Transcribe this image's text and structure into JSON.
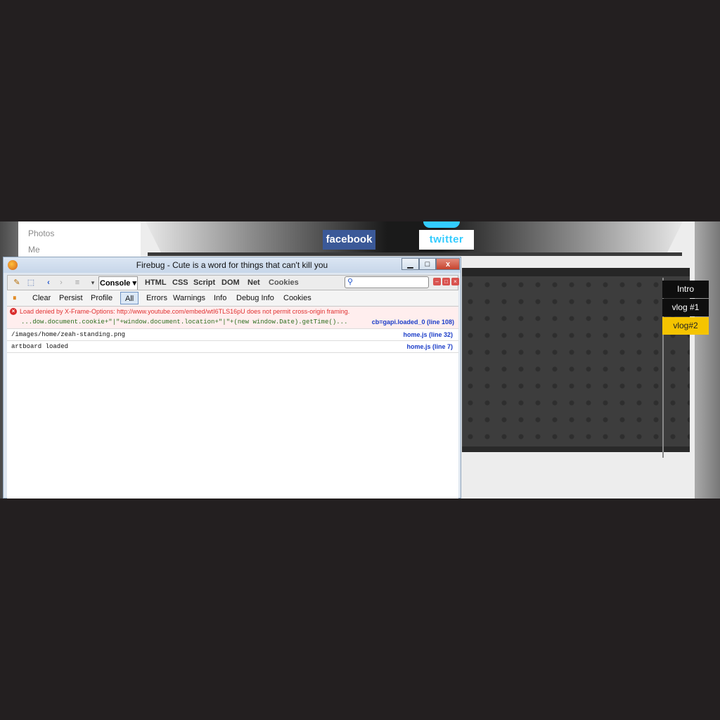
{
  "site": {
    "nav": [
      "Photos",
      "Me"
    ],
    "social": {
      "facebook": "facebook",
      "twitter": "twitter"
    },
    "video_tabs": [
      "Intro",
      "vlog #1",
      "vlog#2"
    ],
    "accent_color": "#f5c400"
  },
  "firebug": {
    "title": "Firebug - Cute is a word for things that can't kill you",
    "window_buttons": {
      "minimize": "▁",
      "maximize": "□",
      "close": "x"
    },
    "panel_dropdown": "Console ▾",
    "tabs": [
      "HTML",
      "CSS",
      "Script",
      "DOM",
      "Net",
      "Cookies"
    ],
    "filters": [
      "Clear",
      "Persist",
      "Profile",
      "All",
      "Errors",
      "Warnings",
      "Info",
      "Debug Info",
      "Cookies"
    ],
    "console": {
      "error": {
        "message": "Load denied by X-Frame-Options: http://www.youtube.com/embed/wtI6TLS16pU does not permit cross-origin framing.",
        "code": "...dow.document.cookie+\"|\"+window.document.location+\"|\"+(new window.Date).getTime()...",
        "source": "cb=gapi.loaded_0 (line 108)"
      },
      "logs": [
        {
          "message": "/images/home/zeah-standing.png",
          "source": "home.js (line 32)"
        },
        {
          "message": "artboard loaded",
          "source": "home.js (line 7)"
        }
      ]
    }
  }
}
